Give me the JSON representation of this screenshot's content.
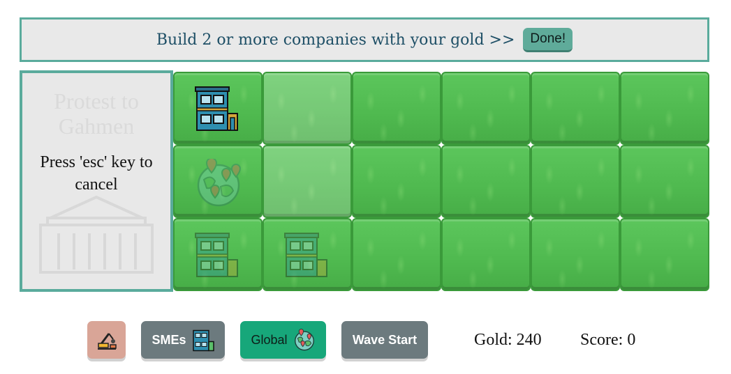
{
  "banner": {
    "message": "Build 2 or more companies with your gold >>",
    "done_label": "Done!"
  },
  "side_panel": {
    "ghost_title": "Protest to Gahmen",
    "hint": "Press 'esc' key to cancel"
  },
  "grid": {
    "rows": 3,
    "cols": 6,
    "items": [
      {
        "row": 0,
        "col": 0,
        "icon": "office-building-icon",
        "state": "built"
      },
      {
        "row": 1,
        "col": 0,
        "icon": "globe-icon",
        "state": "ghost"
      },
      {
        "row": 2,
        "col": 0,
        "icon": "office-building-icon",
        "state": "ghost"
      },
      {
        "row": 2,
        "col": 1,
        "icon": "office-building-icon",
        "state": "ghost"
      }
    ],
    "highlighted": [
      {
        "row": 0,
        "col": 1
      },
      {
        "row": 1,
        "col": 1
      }
    ]
  },
  "toolbar": {
    "demolish_icon": "crane-demolish-icon",
    "smes_label": "SMEs",
    "global_label": "Global",
    "wave_label": "Wave Start"
  },
  "stats": {
    "gold_text": "Gold: 240",
    "score_text": "Score: 0"
  },
  "colors": {
    "accent_teal": "#5aab9c",
    "grass_green": "#4fb94f",
    "global_green": "#17a77a",
    "slate_button": "#6c7a7e",
    "demolish_button": "#d9a597"
  }
}
